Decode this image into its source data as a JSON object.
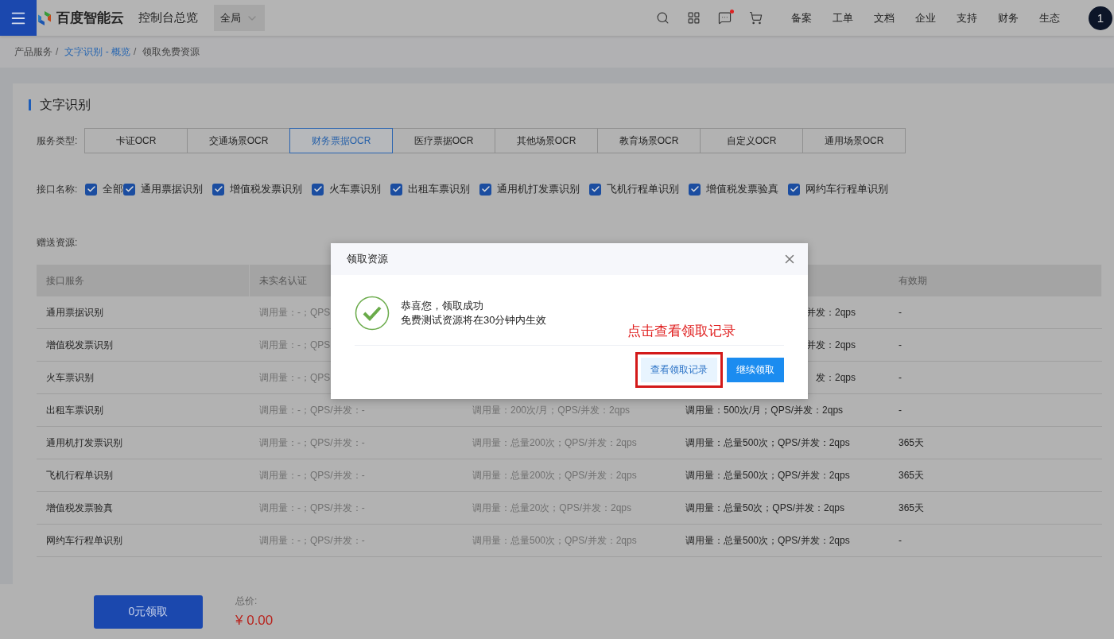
{
  "top_bar": {
    "brand": "百度智能云",
    "title": "控制台总览",
    "scope_select": {
      "value": "全局"
    },
    "icon_buttons": [
      {
        "kind": "search",
        "unread": false
      },
      {
        "kind": "apps",
        "unread": false
      },
      {
        "kind": "messages",
        "unread": true
      },
      {
        "kind": "cart",
        "unread": false
      }
    ],
    "nav_links": [
      "备案",
      "工单",
      "文档",
      "企业",
      "支持",
      "财务",
      "生态"
    ],
    "avatar": "1"
  },
  "breadcrumb": {
    "separator": "/",
    "items": [
      {
        "label": "产品服务",
        "link": false
      },
      {
        "label": "文字识别 - 概览",
        "link": true
      },
      {
        "label": "领取免费资源",
        "link": false
      }
    ]
  },
  "section_title": "文字识别",
  "service_types": {
    "label": "服务类型:",
    "tabs": [
      {
        "label": "卡证OCR",
        "selected": false
      },
      {
        "label": "交通场景OCR",
        "selected": false
      },
      {
        "label": "财务票据OCR",
        "selected": true
      },
      {
        "label": "医疗票据OCR",
        "selected": false
      },
      {
        "label": "其他场景OCR",
        "selected": false
      },
      {
        "label": "教育场景OCR",
        "selected": false
      },
      {
        "label": "自定义OCR",
        "selected": false
      },
      {
        "label": "通用场景OCR",
        "selected": false
      }
    ]
  },
  "interfaces": {
    "label": "接口名称:",
    "items": [
      {
        "label": "全部",
        "checked": true
      },
      {
        "label": "通用票据识别",
        "checked": true
      },
      {
        "label": "增值税发票识别",
        "checked": true
      },
      {
        "label": "火车票识别",
        "checked": true
      },
      {
        "label": "出租车票识别",
        "checked": true
      },
      {
        "label": "通用机打发票识别",
        "checked": true
      },
      {
        "label": "飞机行程单识别",
        "checked": true
      },
      {
        "label": "增值税发票验真",
        "checked": true
      },
      {
        "label": "网约车行程单识别",
        "checked": true
      }
    ]
  },
  "gift_resources": {
    "label": "赠送资源:",
    "table": {
      "columns": [
        "接口服务",
        "未实名认证",
        null,
        null,
        "有效期"
      ],
      "rows": [
        {
          "cells": [
            "通用票据识别",
            "调用量：-；QPS",
            null,
            "并发：2qps",
            "-"
          ]
        },
        {
          "cells": [
            "增值税发票识别",
            "调用量：-；QPS",
            null,
            "并发：2qps",
            "-"
          ]
        },
        {
          "cells": [
            "火车票识别",
            "调用量：-；QPS",
            null,
            "发：2qps",
            "-"
          ]
        },
        {
          "cells": [
            "出租车票识别",
            "调用量：-；QPS/并发：-",
            "调用量：200次/月；QPS/并发：2qps",
            "调用量：500次/月；QPS/并发：2qps",
            "-"
          ]
        },
        {
          "cells": [
            "通用机打发票识别",
            "调用量：-；QPS/并发：-",
            "调用量：总量200次；QPS/并发：2qps",
            "调用量：总量500次；QPS/并发：2qps",
            "365天"
          ]
        },
        {
          "cells": [
            "飞机行程单识别",
            "调用量：-；QPS/并发：-",
            "调用量：总量200次；QPS/并发：2qps",
            "调用量：总量500次；QPS/并发：2qps",
            "365天"
          ]
        },
        {
          "cells": [
            "增值税发票验真",
            "调用量：-；QPS/并发：-",
            "调用量：总量20次；QPS/并发：2qps",
            "调用量：总量50次；QPS/并发：2qps",
            "365天"
          ]
        },
        {
          "cells": [
            "网约车行程单识别",
            "调用量：-；QPS/并发：-",
            "调用量：总量500次；QPS/并发：2qps",
            "调用量：总量500次；QPS/并发：2qps",
            "-"
          ]
        }
      ]
    }
  },
  "footer": {
    "claim_button": "0元领取",
    "total_label": "总价:",
    "total_price": "¥ 0.00"
  },
  "dialog": {
    "title": "领取资源",
    "message_lines": [
      "恭喜您，领取成功",
      "免费测试资源将在30分钟内生效"
    ],
    "buttons": [
      {
        "label": "查看领取记录",
        "kind": "secondary",
        "highlighted": true
      },
      {
        "label": "继续领取",
        "kind": "primary",
        "highlighted": false
      }
    ],
    "annotation": "点击查看领取记录"
  }
}
